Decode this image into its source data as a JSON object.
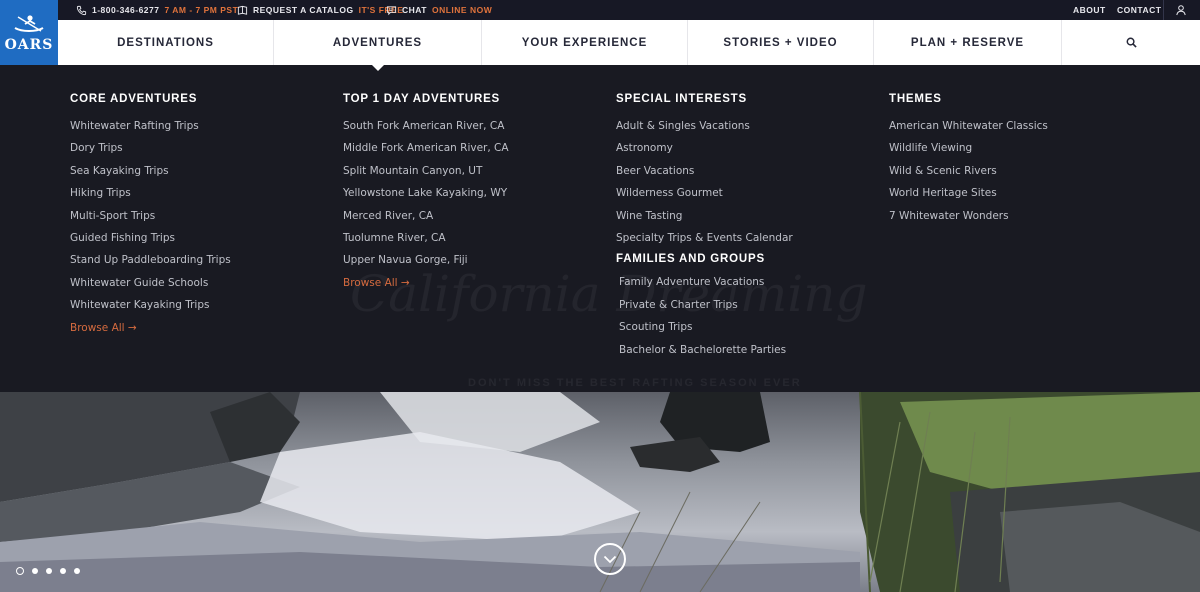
{
  "topbar": {
    "phone": "1-800-346-6277",
    "phone_hours": "7 AM - 7 PM PST",
    "catalog": "REQUEST A CATALOG",
    "catalog_accent": "IT'S FREE",
    "chat": "CHAT",
    "chat_accent": "ONLINE NOW",
    "about": "ABOUT",
    "contact": "CONTACT",
    "accent_color": "#e0733c"
  },
  "logo": {
    "text": "OARS",
    "color": "#1f6cc2"
  },
  "nav": {
    "items": [
      "DESTINATIONS",
      "ADVENTURES",
      "YOUR EXPERIENCE",
      "STORIES + VIDEO",
      "PLAN + RESERVE"
    ],
    "active": "ADVENTURES"
  },
  "mega_menu": {
    "core": {
      "heading": "CORE ADVENTURES",
      "items": [
        "Whitewater Rafting Trips",
        "Dory Trips",
        "Sea Kayaking Trips",
        "Hiking Trips",
        "Multi-Sport Trips",
        "Guided Fishing Trips",
        "Stand Up Paddleboarding Trips",
        "Whitewater Guide Schools",
        "Whitewater Kayaking Trips"
      ],
      "browse": "Browse All →"
    },
    "top1day": {
      "heading": "TOP 1 DAY ADVENTURES",
      "items": [
        "South Fork American River, CA",
        "Middle Fork American River, CA",
        "Split Mountain Canyon, UT",
        "Yellowstone Lake Kayaking, WY",
        "Merced River, CA",
        "Tuolumne River, CA",
        "Upper Navua Gorge, Fiji"
      ],
      "browse": "Browse All →"
    },
    "special": {
      "heading": "SPECIAL INTERESTS",
      "items": [
        "Adult & Singles Vacations",
        "Astronomy",
        "Beer Vacations",
        "Wilderness Gourmet",
        "Wine Tasting",
        "Specialty Trips & Events Calendar"
      ]
    },
    "families": {
      "heading": "FAMILIES AND GROUPS",
      "items": [
        "Family Adventure Vacations",
        "Private & Charter Trips",
        "Scouting Trips",
        "Bachelor & Bachelorette Parties"
      ]
    },
    "themes": {
      "heading": "THEMES",
      "items": [
        "American Whitewater Classics",
        "Wildlife Viewing",
        "Wild & Scenic Rivers",
        "World Heritage Sites",
        "7 Whitewater Wonders"
      ]
    },
    "link_color": "#d66b3f"
  },
  "hero": {
    "ghost_title": "California Dreaming",
    "ghost_tagline": "DON'T MISS THE BEST RAFTING SEASON EVER",
    "slide_count": 5,
    "active_slide": 1
  }
}
